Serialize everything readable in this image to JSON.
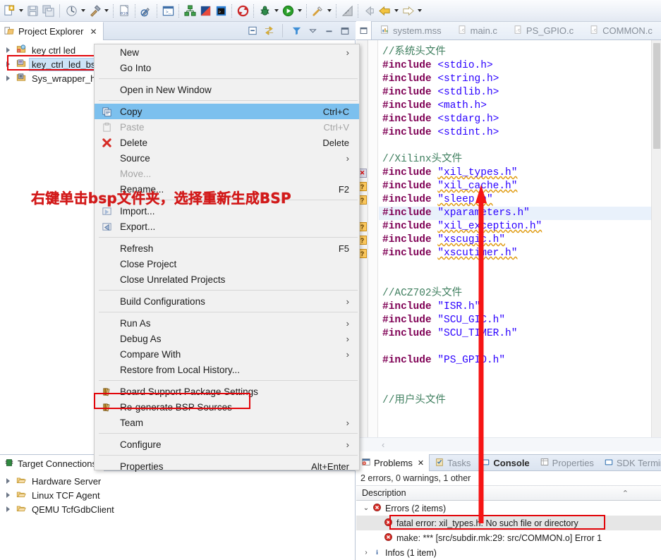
{
  "toolbar": {
    "icons": [
      {
        "name": "new-wizard-icon",
        "kind": "newfile"
      },
      {
        "name": "new-wizard-dropdown-arrow",
        "kind": "arrow"
      },
      {
        "name": "save-icon",
        "kind": "save"
      },
      {
        "name": "save-all-icon",
        "kind": "saveall"
      },
      {
        "name": "sep",
        "kind": "sep"
      },
      {
        "name": "build-all-icon",
        "kind": "buildall"
      },
      {
        "name": "build-all-dropdown-arrow",
        "kind": "arrow"
      },
      {
        "name": "build-hammer-icon",
        "kind": "hammer"
      },
      {
        "name": "build-hammer-dropdown-arrow",
        "kind": "arrow"
      },
      {
        "name": "sep",
        "kind": "dotsep"
      },
      {
        "name": "program-flash-icon",
        "kind": "binary"
      },
      {
        "name": "sep",
        "kind": "dotsep"
      },
      {
        "name": "dump-restore-icon",
        "kind": "nosign"
      },
      {
        "name": "sep",
        "kind": "dotsep"
      },
      {
        "name": "launch-shell-icon",
        "kind": "console"
      },
      {
        "name": "sep",
        "kind": "dotsep"
      },
      {
        "name": "xsct-console-icon",
        "kind": "green-blocks"
      },
      {
        "name": "vivado-icon",
        "kind": "vivado"
      },
      {
        "name": "terminal-icon",
        "kind": "terminal"
      },
      {
        "name": "sep",
        "kind": "dotsep"
      },
      {
        "name": "refresh-icon",
        "kind": "refresh"
      },
      {
        "name": "sep",
        "kind": "dotsep"
      },
      {
        "name": "debug-icon",
        "kind": "bug"
      },
      {
        "name": "debug-dropdown-arrow",
        "kind": "arrow"
      },
      {
        "name": "run-icon",
        "kind": "run"
      },
      {
        "name": "run-dropdown-arrow",
        "kind": "arrow"
      },
      {
        "name": "sep",
        "kind": "dotsep"
      },
      {
        "name": "external-tools-icon",
        "kind": "wrench"
      },
      {
        "name": "external-tools-dropdown-arrow",
        "kind": "arrow"
      },
      {
        "name": "sep",
        "kind": "dotsep"
      },
      {
        "name": "perspective-icon",
        "kind": "ruler"
      },
      {
        "name": "sep",
        "kind": "dotsep"
      },
      {
        "name": "back-icon",
        "kind": "backgray"
      },
      {
        "name": "back-history-icon",
        "kind": "backyellow"
      },
      {
        "name": "back-history-dropdown-arrow",
        "kind": "arrow"
      },
      {
        "name": "forward-icon",
        "kind": "forward"
      },
      {
        "name": "forward-dropdown-arrow",
        "kind": "arrow"
      }
    ]
  },
  "project_explorer": {
    "tab_label": "Project Explorer",
    "close_glyph": "✕",
    "view_buttons": [
      "collapse-all-icon",
      "link-with-editor-icon",
      "filter-icon",
      "view-menu-icon",
      "minimize-icon",
      "maximize-icon"
    ],
    "tree": [
      {
        "label": "key ctrl led",
        "icon": "c-project-icon",
        "selected": false
      },
      {
        "label": "key_ctrl_led_bsp",
        "icon": "bsp-project-icon",
        "selected": true
      },
      {
        "label": "Sys_wrapper_hw",
        "icon": "hw-platform-icon",
        "selected": false
      }
    ]
  },
  "target_connections": {
    "tab_label": "Target Connections",
    "items": [
      {
        "label": "Hardware Server"
      },
      {
        "label": "Linux TCF Agent"
      },
      {
        "label": "QEMU TcfGdbClient"
      }
    ]
  },
  "editor": {
    "tabs": [
      {
        "label": "system.mss",
        "icon": "mss-file-icon"
      },
      {
        "label": "main.c",
        "icon": "c-file-icon"
      },
      {
        "label": "PS_GPIO.c",
        "icon": "c-file-icon"
      },
      {
        "label": "COMMON.c",
        "icon": "c-file-icon"
      }
    ],
    "hscroll_glyph": "‹",
    "lines": [
      {
        "text": "//系统头文件",
        "type": "comment"
      },
      {
        "text": "#include <stdio.h>",
        "type": "include"
      },
      {
        "text": "#include <string.h>",
        "type": "include"
      },
      {
        "text": "#include <stdlib.h>",
        "type": "include"
      },
      {
        "text": "#include <math.h>",
        "type": "include"
      },
      {
        "text": "#include <stdarg.h>",
        "type": "include"
      },
      {
        "text": "#include <stdint.h>",
        "type": "include"
      },
      {
        "text": "",
        "type": "blank"
      },
      {
        "text": "//Xilinx头文件",
        "type": "comment"
      },
      {
        "text": "#include \"xil_types.h\"",
        "type": "include-q",
        "squiggle": true,
        "marker": "error"
      },
      {
        "text": "#include \"xil_cache.h\"",
        "type": "include-q",
        "squiggle": true,
        "marker": "warn"
      },
      {
        "text": "#include \"sleep.h\"",
        "type": "include-q",
        "squiggle": true,
        "marker": "warn"
      },
      {
        "text": "#include \"xparameters.h\"",
        "type": "include-q",
        "highlight": true
      },
      {
        "text": "#include \"xil_exception.h\"",
        "type": "include-q",
        "squiggle": true,
        "marker": "warn"
      },
      {
        "text": "#include \"xscugic.h\"",
        "type": "include-q",
        "squiggle": true,
        "marker": "warn"
      },
      {
        "text": "#include \"xscutimer.h\"",
        "type": "include-q",
        "squiggle": true,
        "marker": "warn"
      },
      {
        "text": "",
        "type": "blank"
      },
      {
        "text": "",
        "type": "blank"
      },
      {
        "text": "//ACZ702头文件",
        "type": "comment"
      },
      {
        "text": "#include \"ISR.h\"",
        "type": "include-q"
      },
      {
        "text": "#include \"SCU_GIC.h\"",
        "type": "include-q"
      },
      {
        "text": "#include \"SCU_TIMER.h\"",
        "type": "include-q"
      },
      {
        "text": "",
        "type": "blank"
      },
      {
        "text": "#include \"PS_GPIO.h\"",
        "type": "include-q"
      },
      {
        "text": "",
        "type": "blank"
      },
      {
        "text": "",
        "type": "blank"
      },
      {
        "text": "//用户头文件",
        "type": "comment"
      }
    ]
  },
  "problems_view": {
    "tabs": [
      {
        "label": "Problems",
        "icon": "problems-icon",
        "active": true,
        "close": "✕"
      },
      {
        "label": "Tasks",
        "icon": "tasks-icon",
        "active": false
      },
      {
        "label": "Console",
        "icon": "console-icon",
        "active": false,
        "bold": true
      },
      {
        "label": "Properties",
        "icon": "properties-icon",
        "active": false
      },
      {
        "label": "SDK Termina",
        "icon": "terminal-icon",
        "active": false
      }
    ],
    "summary": "2 errors, 0 warnings, 1 other",
    "column_header": "Description",
    "sort_glyph": "⌃",
    "rows": [
      {
        "label": "Errors (2 items)",
        "level": 0,
        "icon": "error-icon",
        "twisty": "expanded",
        "selected": false
      },
      {
        "label": "fatal error: xil_types.h: No such file or directory",
        "level": 1,
        "icon": "error-icon",
        "twisty": "none",
        "selected": true
      },
      {
        "label": "make: *** [src/subdir.mk:29: src/COMMON.o] Error 1",
        "level": 1,
        "icon": "error-icon",
        "twisty": "none",
        "selected": false
      },
      {
        "label": "Infos (1 item)",
        "level": 0,
        "icon": "info-icon",
        "twisty": "collapsed",
        "selected": false
      }
    ]
  },
  "context_menu": {
    "items": [
      {
        "label": "New",
        "submenu": true,
        "icon": null,
        "disabled": false,
        "highlight": false
      },
      {
        "label": "Go Into",
        "submenu": false,
        "icon": null,
        "disabled": false,
        "highlight": false
      },
      {
        "sep": true
      },
      {
        "label": "Open in New Window",
        "submenu": false,
        "icon": null,
        "disabled": false,
        "highlight": false
      },
      {
        "sep": true
      },
      {
        "label": "Copy",
        "shortcut": "Ctrl+C",
        "icon": "copy-icon",
        "disabled": false,
        "highlight": true
      },
      {
        "label": "Paste",
        "shortcut": "Ctrl+V",
        "icon": "paste-icon",
        "disabled": true,
        "highlight": false
      },
      {
        "label": "Delete",
        "shortcut": "Delete",
        "icon": "delete-icon",
        "disabled": false,
        "highlight": false
      },
      {
        "label": "Source",
        "submenu": true,
        "icon": null,
        "disabled": false,
        "highlight": false
      },
      {
        "label": "Move...",
        "submenu": false,
        "icon": null,
        "disabled": true,
        "highlight": false
      },
      {
        "label": "Rename...",
        "shortcut": "F2",
        "icon": null,
        "disabled": false,
        "highlight": false
      },
      {
        "sep": true
      },
      {
        "label": "Import...",
        "submenu": false,
        "icon": "import-icon",
        "disabled": false,
        "highlight": false
      },
      {
        "label": "Export...",
        "submenu": false,
        "icon": "export-icon",
        "disabled": false,
        "highlight": false
      },
      {
        "sep": true
      },
      {
        "label": "Refresh",
        "shortcut": "F5",
        "icon": null,
        "disabled": false,
        "highlight": false
      },
      {
        "label": "Close Project",
        "submenu": false,
        "icon": null,
        "disabled": false,
        "highlight": false
      },
      {
        "label": "Close Unrelated Projects",
        "submenu": false,
        "icon": null,
        "disabled": false,
        "highlight": false
      },
      {
        "sep": true
      },
      {
        "label": "Build Configurations",
        "submenu": true,
        "icon": null,
        "disabled": false,
        "highlight": false
      },
      {
        "sep": true
      },
      {
        "label": "Run As",
        "submenu": true,
        "icon": null,
        "disabled": false,
        "highlight": false
      },
      {
        "label": "Debug As",
        "submenu": true,
        "icon": null,
        "disabled": false,
        "highlight": false
      },
      {
        "label": "Compare With",
        "submenu": true,
        "icon": null,
        "disabled": false,
        "highlight": false
      },
      {
        "label": "Restore from Local History...",
        "submenu": false,
        "icon": null,
        "disabled": false,
        "highlight": false
      },
      {
        "sep": true
      },
      {
        "label": "Board Support Package Settings",
        "submenu": false,
        "icon": "bsp-icon",
        "disabled": false,
        "highlight": false
      },
      {
        "label": "Re-generate BSP Sources",
        "submenu": false,
        "icon": "bsp-icon",
        "disabled": false,
        "highlight": false
      },
      {
        "label": "Team",
        "submenu": true,
        "icon": null,
        "disabled": false,
        "highlight": false
      },
      {
        "sep": true
      },
      {
        "label": "Configure",
        "submenu": true,
        "icon": null,
        "disabled": false,
        "highlight": false
      },
      {
        "sep": true
      },
      {
        "label": "Properties",
        "shortcut": "Alt+Enter",
        "icon": null,
        "disabled": false,
        "highlight": false
      }
    ]
  },
  "annotations": {
    "note_text": "右键单击bsp文件夹，选择重新生成BSP",
    "note_color": "#d21a1a",
    "highlight_color": "#e2050a"
  }
}
